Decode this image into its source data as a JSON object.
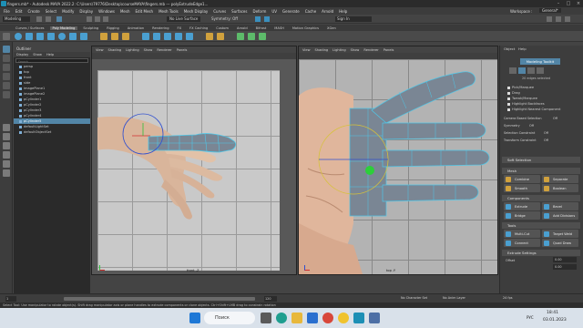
{
  "window": {
    "title": "fingers.mb* - Autodesk MAYA 2022.2: C:\\Users\\79776\\Desktop\\courseMAYA\\fingers.mb   ---   polyExtrudeEdge1...",
    "workspace_label": "Workspace :",
    "workspace_value": "General*"
  },
  "menubar": [
    "File",
    "Edit",
    "Create",
    "Select",
    "Modify",
    "Display",
    "Windows",
    "Mesh",
    "Edit Mesh",
    "Mesh Tools",
    "Mesh Display",
    "Curves",
    "Surfaces",
    "Deform",
    "UV",
    "Generate",
    "Cache",
    "Arnold",
    "Help"
  ],
  "statusline": {
    "mode": "Modeling",
    "live_surface": "No Live Surface",
    "symmetry": "Symmetry: Off",
    "sign_in": "Sign In"
  },
  "shelf_tabs": [
    {
      "label": "Curves / Surfaces",
      "active": false
    },
    {
      "label": "Poly Modeling",
      "active": true
    },
    {
      "label": "Sculpting",
      "active": false
    },
    {
      "label": "Rigging",
      "active": false
    },
    {
      "label": "Animation",
      "active": false
    },
    {
      "label": "Rendering",
      "active": false
    },
    {
      "label": "FX",
      "active": false
    },
    {
      "label": "FX Caching",
      "active": false
    },
    {
      "label": "Custom",
      "active": false
    },
    {
      "label": "Arnold",
      "active": false
    },
    {
      "label": "Bifrost",
      "active": false
    },
    {
      "label": "MASH",
      "active": false
    },
    {
      "label": "Motion Graphics",
      "active": false
    },
    {
      "label": "XGen",
      "active": false
    }
  ],
  "outliner": {
    "title": "Outliner",
    "menu": [
      "Display",
      "Show",
      "Help"
    ],
    "search_placeholder": "Search...",
    "items": [
      {
        "label": "persp",
        "selected": false
      },
      {
        "label": "top",
        "selected": false
      },
      {
        "label": "front",
        "selected": false
      },
      {
        "label": "side",
        "selected": false
      },
      {
        "label": "imagePlane1",
        "selected": false
      },
      {
        "label": "imagePlane2",
        "selected": false
      },
      {
        "label": "pCylinder1",
        "selected": false
      },
      {
        "label": "pCylinder2",
        "selected": false
      },
      {
        "label": "pCylinder3",
        "selected": false
      },
      {
        "label": "pCylinder4",
        "selected": false
      },
      {
        "label": "pCylinder5",
        "selected": true
      },
      {
        "label": "defaultLightSet",
        "selected": false
      },
      {
        "label": "defaultObjectSet",
        "selected": false
      }
    ]
  },
  "viewport_menu": [
    "View",
    "Shading",
    "Lighting",
    "Show",
    "Renderer",
    "Panels"
  ],
  "viewport_left": {
    "camera_label": "front -Z"
  },
  "viewport_right": {
    "camera_label": "top -Y"
  },
  "modeling_toolkit": {
    "tabs": [
      "Object",
      "Help"
    ],
    "title": "Modeling Toolkit",
    "status": "20 edges selected",
    "checks": [
      "Pick/Marquee",
      "Drag",
      "Tweak/Marquee",
      "Highlight Backfaces",
      "Highlight Nearest Component"
    ],
    "settings": [
      {
        "label": "Camera Based Selection",
        "value": "Off"
      },
      {
        "label": "Symmetry",
        "value": "Off"
      },
      {
        "label": "Selection Constraint",
        "value": "Off"
      },
      {
        "label": "Transform Constraint",
        "value": "Off"
      }
    ],
    "soft_selection": "Soft Selection",
    "sections": {
      "mesh": "Mesh",
      "components": "Components",
      "tools": "Tools",
      "extrude_settings": "Extrude Settings"
    },
    "mesh_buttons": [
      "Combine",
      "Separate",
      "Smooth",
      "Boolean"
    ],
    "component_buttons": [
      "Extrude",
      "Bevel",
      "Bridge",
      "Add Divisions"
    ],
    "tool_buttons": [
      "Multi-Cut",
      "Target Weld",
      "Connect",
      "Quad Draw"
    ],
    "extrude_fields": {
      "label": "Offset",
      "values": [
        "0.00",
        "0.00"
      ]
    }
  },
  "timebar": {
    "start": "1",
    "end": "120",
    "character_set": "No Character Set",
    "anim_layer": "No Anim Layer",
    "fps": "24 fps"
  },
  "help_line": "Select Tool: Use manipulator to rotate object(s). Shift drag manipulator axis or plane handles to extrude components or clone objects. Ctrl+Shift+LMB drag to constrain rotation",
  "taskbar": {
    "search_placeholder": "Поиск",
    "language": "РУС",
    "time": "18:41",
    "date": "03.01.2023"
  },
  "colors": {
    "selection": "#5285a6",
    "mesh": "#7a8694",
    "wire": "#4fc7e8",
    "accent": "#2ccf3a"
  }
}
